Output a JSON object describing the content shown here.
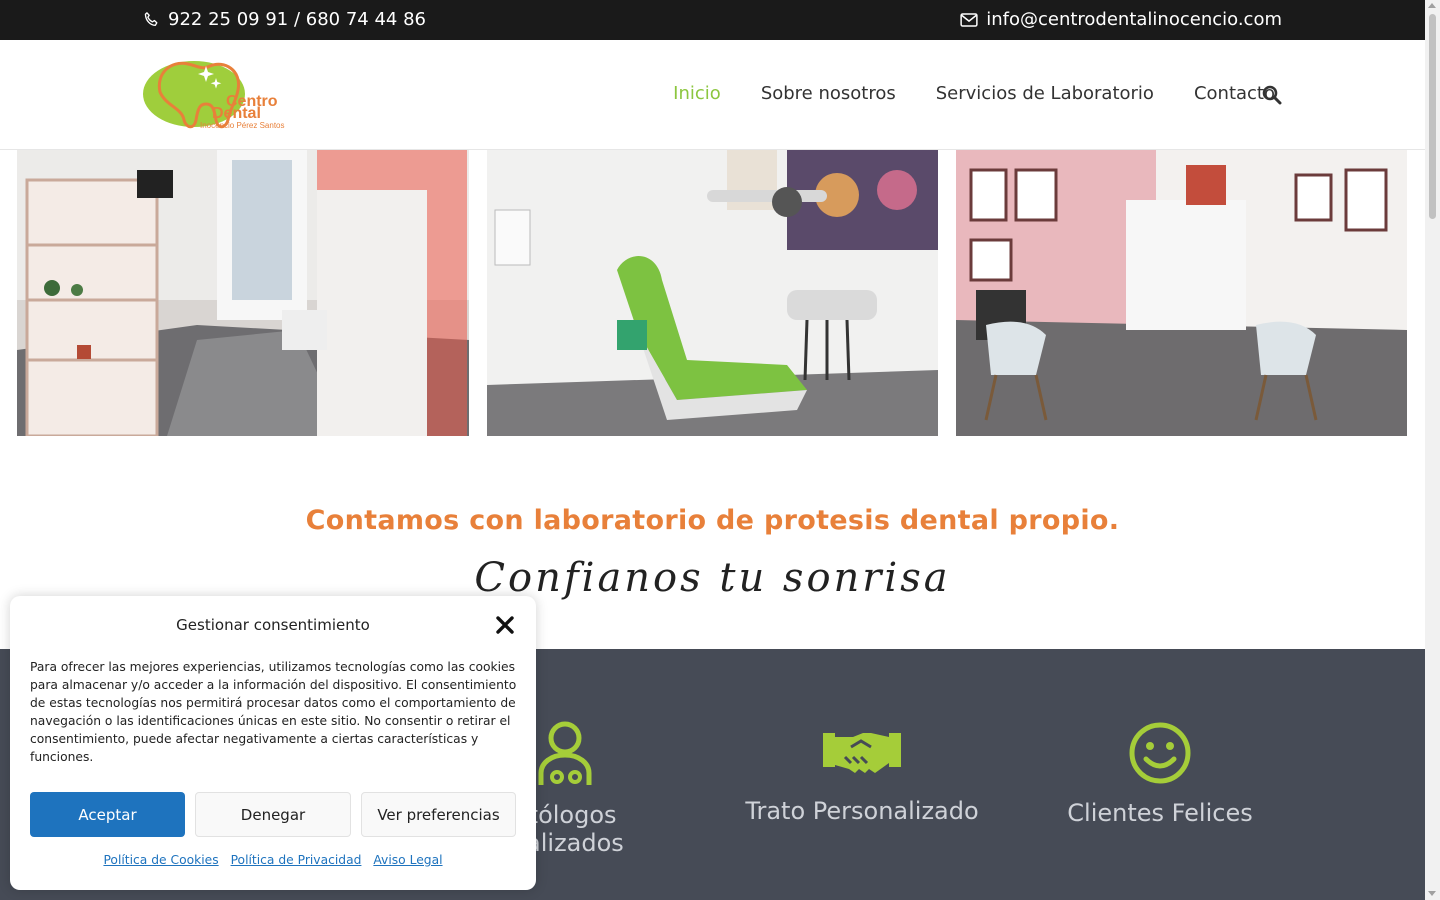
{
  "topbar": {
    "phone": "922 25 09 91 / 680 74 44 86",
    "email": "info@centrodentalinocencio.com",
    "phone_icon": "phone-icon",
    "email_icon": "envelope-icon"
  },
  "header": {
    "logo": {
      "line1": "Centro",
      "line2": "Dental",
      "line3": "Inocencio Pérez Santos"
    },
    "nav": [
      "Inicio",
      "Sobre nosotros",
      "Servicios de Laboratorio",
      "Contacto"
    ],
    "active_nav": "Inicio",
    "search_icon": "search-icon"
  },
  "hero": {
    "tagline": "Contamos con laboratorio de protesis dental propio.",
    "script": "Confianos tu sonrisa"
  },
  "features": [
    {
      "icon": "user-doctor-icon",
      "label_line1": "ntólogos",
      "label_line2": "cializados"
    },
    {
      "icon": "handshake-icon",
      "label_line1": "Trato Personalizado",
      "label_line2": ""
    },
    {
      "icon": "smile-icon",
      "label_line1": "Clientes Felices",
      "label_line2": ""
    }
  ],
  "consent": {
    "title": "Gestionar consentimiento",
    "body": "Para ofrecer las mejores experiencias, utilizamos tecnologías como las cookies para almacenar y/o acceder a la información del dispositivo. El consentimiento de estas tecnologías nos permitirá procesar datos como el comportamiento de navegación o las identificaciones únicas en este sitio. No consentir o retirar el consentimiento, puede afectar negativamente a ciertas características y funciones.",
    "accept": "Aceptar",
    "deny": "Denegar",
    "prefs": "Ver preferencias",
    "links": [
      "Política de Cookies",
      "Política de Privacidad",
      "Aviso Legal"
    ]
  },
  "colors": {
    "brand_green": "#8cc63f",
    "brand_orange": "#e8803a",
    "accept_blue": "#1e73be",
    "band_dark": "#464b56"
  }
}
